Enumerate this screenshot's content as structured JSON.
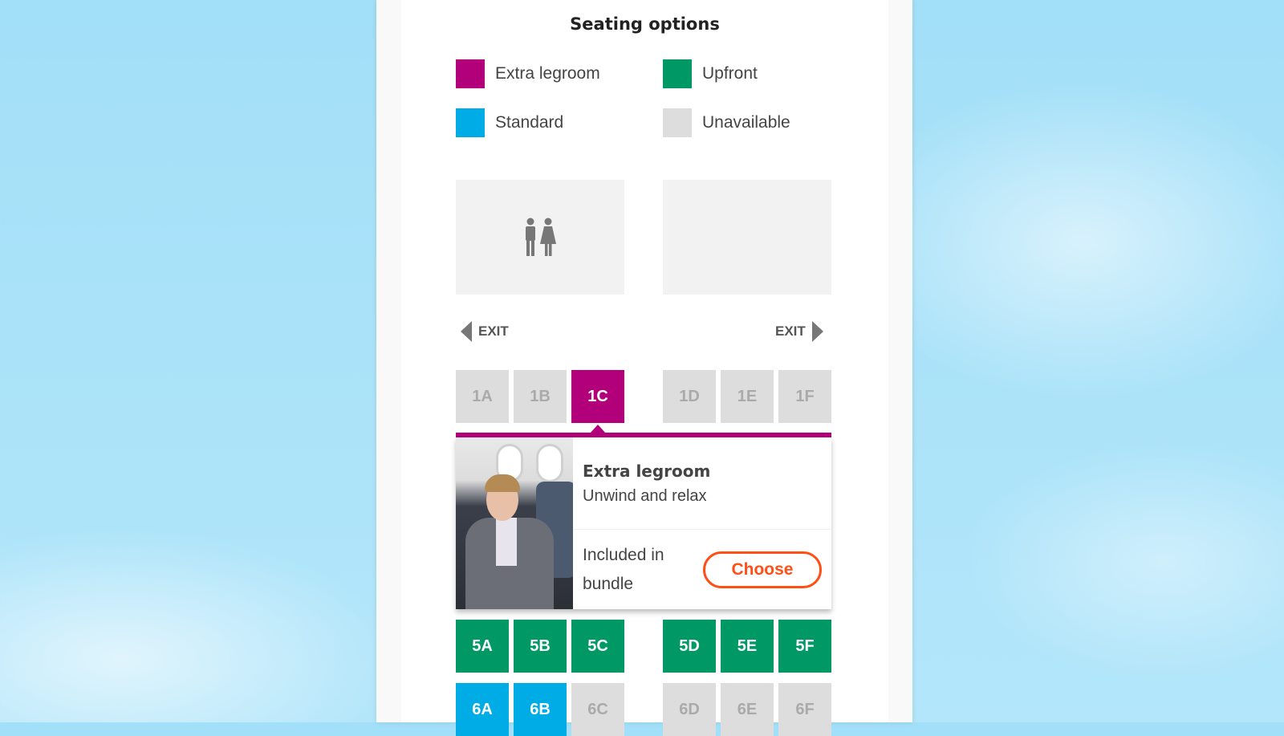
{
  "title": "Seating options",
  "legend": [
    {
      "label": "Extra legroom",
      "color": "#b2007a"
    },
    {
      "label": "Upfront",
      "color": "#009966"
    },
    {
      "label": "Standard",
      "color": "#00ace6"
    },
    {
      "label": "Unavailable",
      "color": "#dddddd"
    }
  ],
  "facilities": {
    "left_icon": "toilet-icon",
    "exit_left": "EXIT",
    "exit_right": "EXIT"
  },
  "rows": [
    [
      {
        "id": "1A",
        "type": "unavailable"
      },
      {
        "id": "1B",
        "type": "unavailable"
      },
      {
        "id": "1C",
        "type": "extra-legroom",
        "selected": true
      },
      {
        "id": "1D",
        "type": "unavailable"
      },
      {
        "id": "1E",
        "type": "unavailable"
      },
      {
        "id": "1F",
        "type": "unavailable"
      }
    ],
    [
      {
        "id": "5A",
        "type": "upfront"
      },
      {
        "id": "5B",
        "type": "upfront"
      },
      {
        "id": "5C",
        "type": "upfront"
      },
      {
        "id": "5D",
        "type": "upfront"
      },
      {
        "id": "5E",
        "type": "upfront"
      },
      {
        "id": "5F",
        "type": "upfront"
      }
    ],
    [
      {
        "id": "6A",
        "type": "standard"
      },
      {
        "id": "6B",
        "type": "standard"
      },
      {
        "id": "6C",
        "type": "unavailable"
      },
      {
        "id": "6D",
        "type": "unavailable"
      },
      {
        "id": "6E",
        "type": "unavailable"
      },
      {
        "id": "6F",
        "type": "unavailable"
      }
    ]
  ],
  "popup": {
    "title": "Extra legroom",
    "subtitle": "Unwind and relax",
    "price_text": "Included in bundle",
    "choose_label": "Choose"
  }
}
